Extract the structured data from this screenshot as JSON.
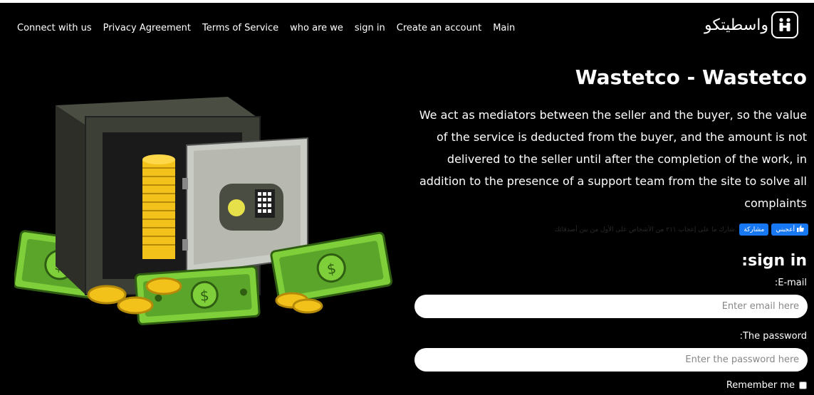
{
  "nav": {
    "links": [
      "Connect with us",
      "Privacy Agreement",
      "Terms of Service",
      "who are we",
      "sign in",
      "Create an account",
      "Main"
    ],
    "logo_text": "واسطيتكو",
    "logo_icon": "handshake-icon"
  },
  "hero": {
    "title": "Wastetco - Wastetco",
    "description": "We act as mediators between the seller and the buyer, so the value of the service is deducted from the buyer, and the amount is not delivered to the seller until after the completion of the work, in addition to the presence of a support team from the site to solve all complaints",
    "illustration": "safe-with-money-illustration"
  },
  "social": {
    "count_text": "شارك ما على إعجاب ٢١١ من الأشخاص على الأول من بين أصدقائك.",
    "share_label": "مشاركة",
    "like_label": "أعجبني",
    "like_icon": "thumbs-up-icon",
    "brand_color": "#1877f2"
  },
  "signin": {
    "heading": ":sign in",
    "email_label": ":E-mail",
    "email_placeholder": "Enter email here",
    "email_value": "",
    "password_label": ":The password",
    "password_placeholder": "Enter the password here",
    "password_value": "",
    "remember_label": "Remember me",
    "remember_checked": false
  }
}
